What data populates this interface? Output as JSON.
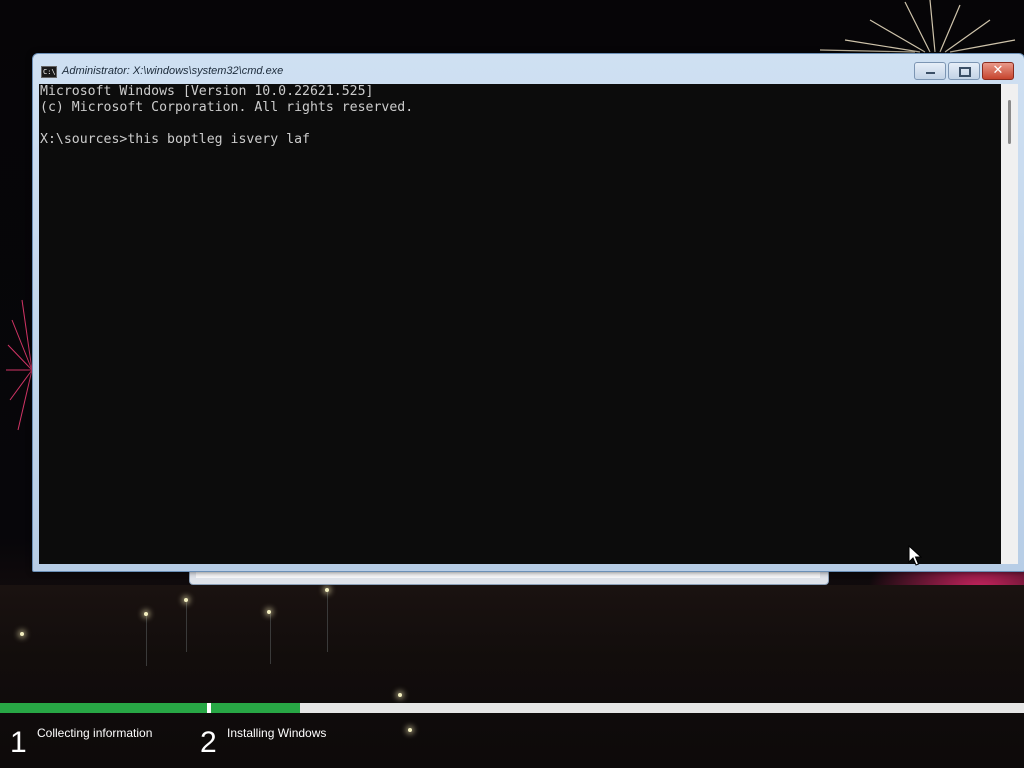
{
  "window": {
    "title": "Administrator: X:\\windows\\system32\\cmd.exe",
    "icon_label": "C:\\",
    "minimize_label": "Minimize",
    "maximize_label": "Maximize",
    "close_label": "✕"
  },
  "console": {
    "lines": [
      "Microsoft Windows [Version 10.0.22621.525]",
      "(c) Microsoft Corporation. All rights reserved.",
      "",
      "X:\\sources>this boptleg isvery laf"
    ]
  },
  "setup_steps": [
    {
      "number": "1",
      "label": "Collecting information"
    },
    {
      "number": "2",
      "label": "Installing Windows"
    }
  ],
  "progress": {
    "step1_fraction": 1.0,
    "step2_fraction": 0.11,
    "color": "#28a745"
  },
  "icons": {
    "window_icon": "cmd-icon",
    "cursor": "mouse-pointer-icon"
  },
  "colors": {
    "console_bg": "#0c0c0c",
    "console_text": "#cccccc",
    "titlebar": "#cfe0f2",
    "close_button": "#c6442e"
  }
}
